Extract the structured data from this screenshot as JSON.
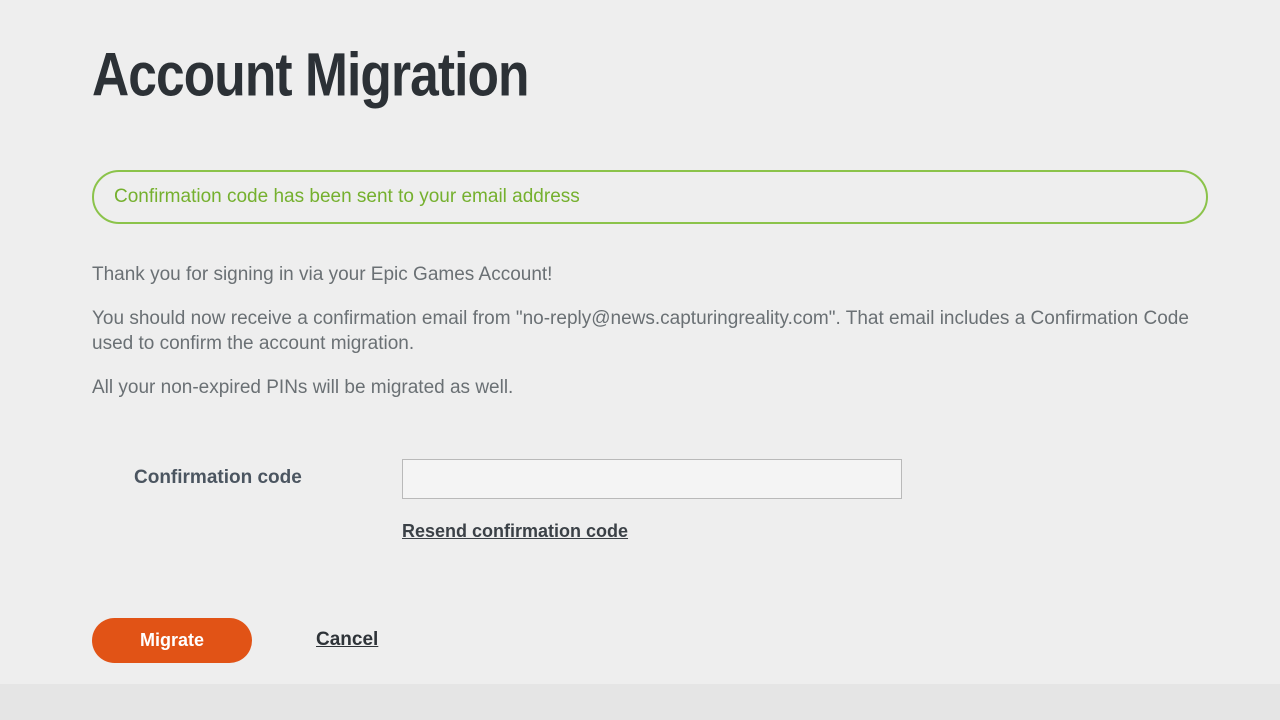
{
  "page": {
    "title": "Account Migration"
  },
  "banner": {
    "message": "Confirmation code has been sent to your email address"
  },
  "body": {
    "p1": "Thank you for signing in via your Epic Games Account!",
    "p2": "You should now receive a confirmation email from \"no-reply@news.capturingreality.com\". That email includes a Confirmation Code used to confirm the account migration.",
    "p3": "All your non-expired PINs will be migrated as well."
  },
  "form": {
    "confirmation_label": "Confirmation code",
    "confirmation_value": "",
    "resend_label": "Resend confirmation code"
  },
  "actions": {
    "migrate_label": "Migrate",
    "cancel_label": "Cancel"
  }
}
